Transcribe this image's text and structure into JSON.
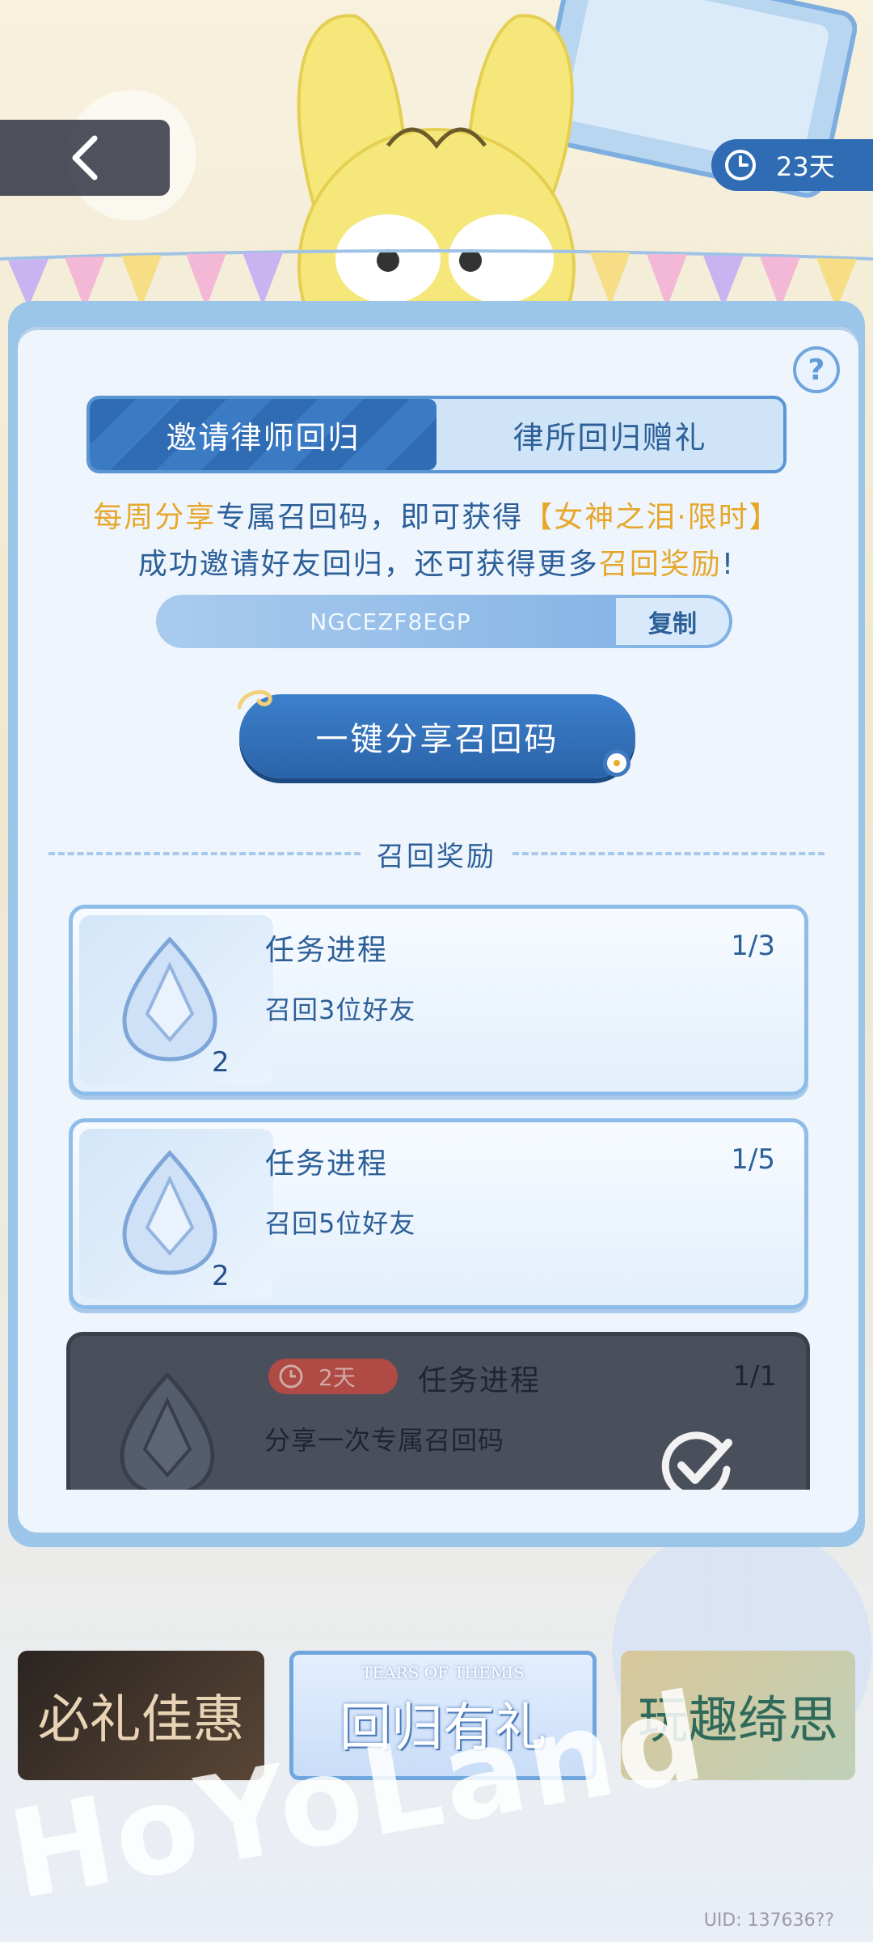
{
  "top": {
    "timer_text": "23天"
  },
  "tabs": [
    {
      "label": "邀请律师回归",
      "active": true
    },
    {
      "label": "律所回归赠礼",
      "active": false
    }
  ],
  "help_label": "?",
  "info": {
    "line1_part1": "每周分享",
    "line1_part2": "专属召回码，即可获得",
    "line1_highlight": "【女神之泪·限时】",
    "line2_part1": "成功邀请好友回归，还可获得更多",
    "line2_highlight": "召回奖励",
    "line2_end": "!"
  },
  "code": {
    "value": "NGCEZF8EGP",
    "copy_label": "复制"
  },
  "share_button": "一键分享召回码",
  "section_title": "召回奖励",
  "rewards": [
    {
      "title": "任务进程",
      "progress": "1/3",
      "desc": "召回3位好友",
      "qty": "2"
    },
    {
      "title": "任务进程",
      "progress": "1/5",
      "desc": "召回5位好友",
      "qty": "2"
    },
    {
      "title": "任务进程",
      "progress": "1/1",
      "desc": "分享一次专属召回码",
      "expire": "2天",
      "completed": true
    }
  ],
  "banners": {
    "b1": "必礼佳惠",
    "b2_sub": "TEARS OF THEMIS",
    "b2_main": "回归有礼",
    "b3": "玩趣绮思"
  },
  "bottom_logo": "HoYoLand",
  "uid": "UID: 137636??"
}
